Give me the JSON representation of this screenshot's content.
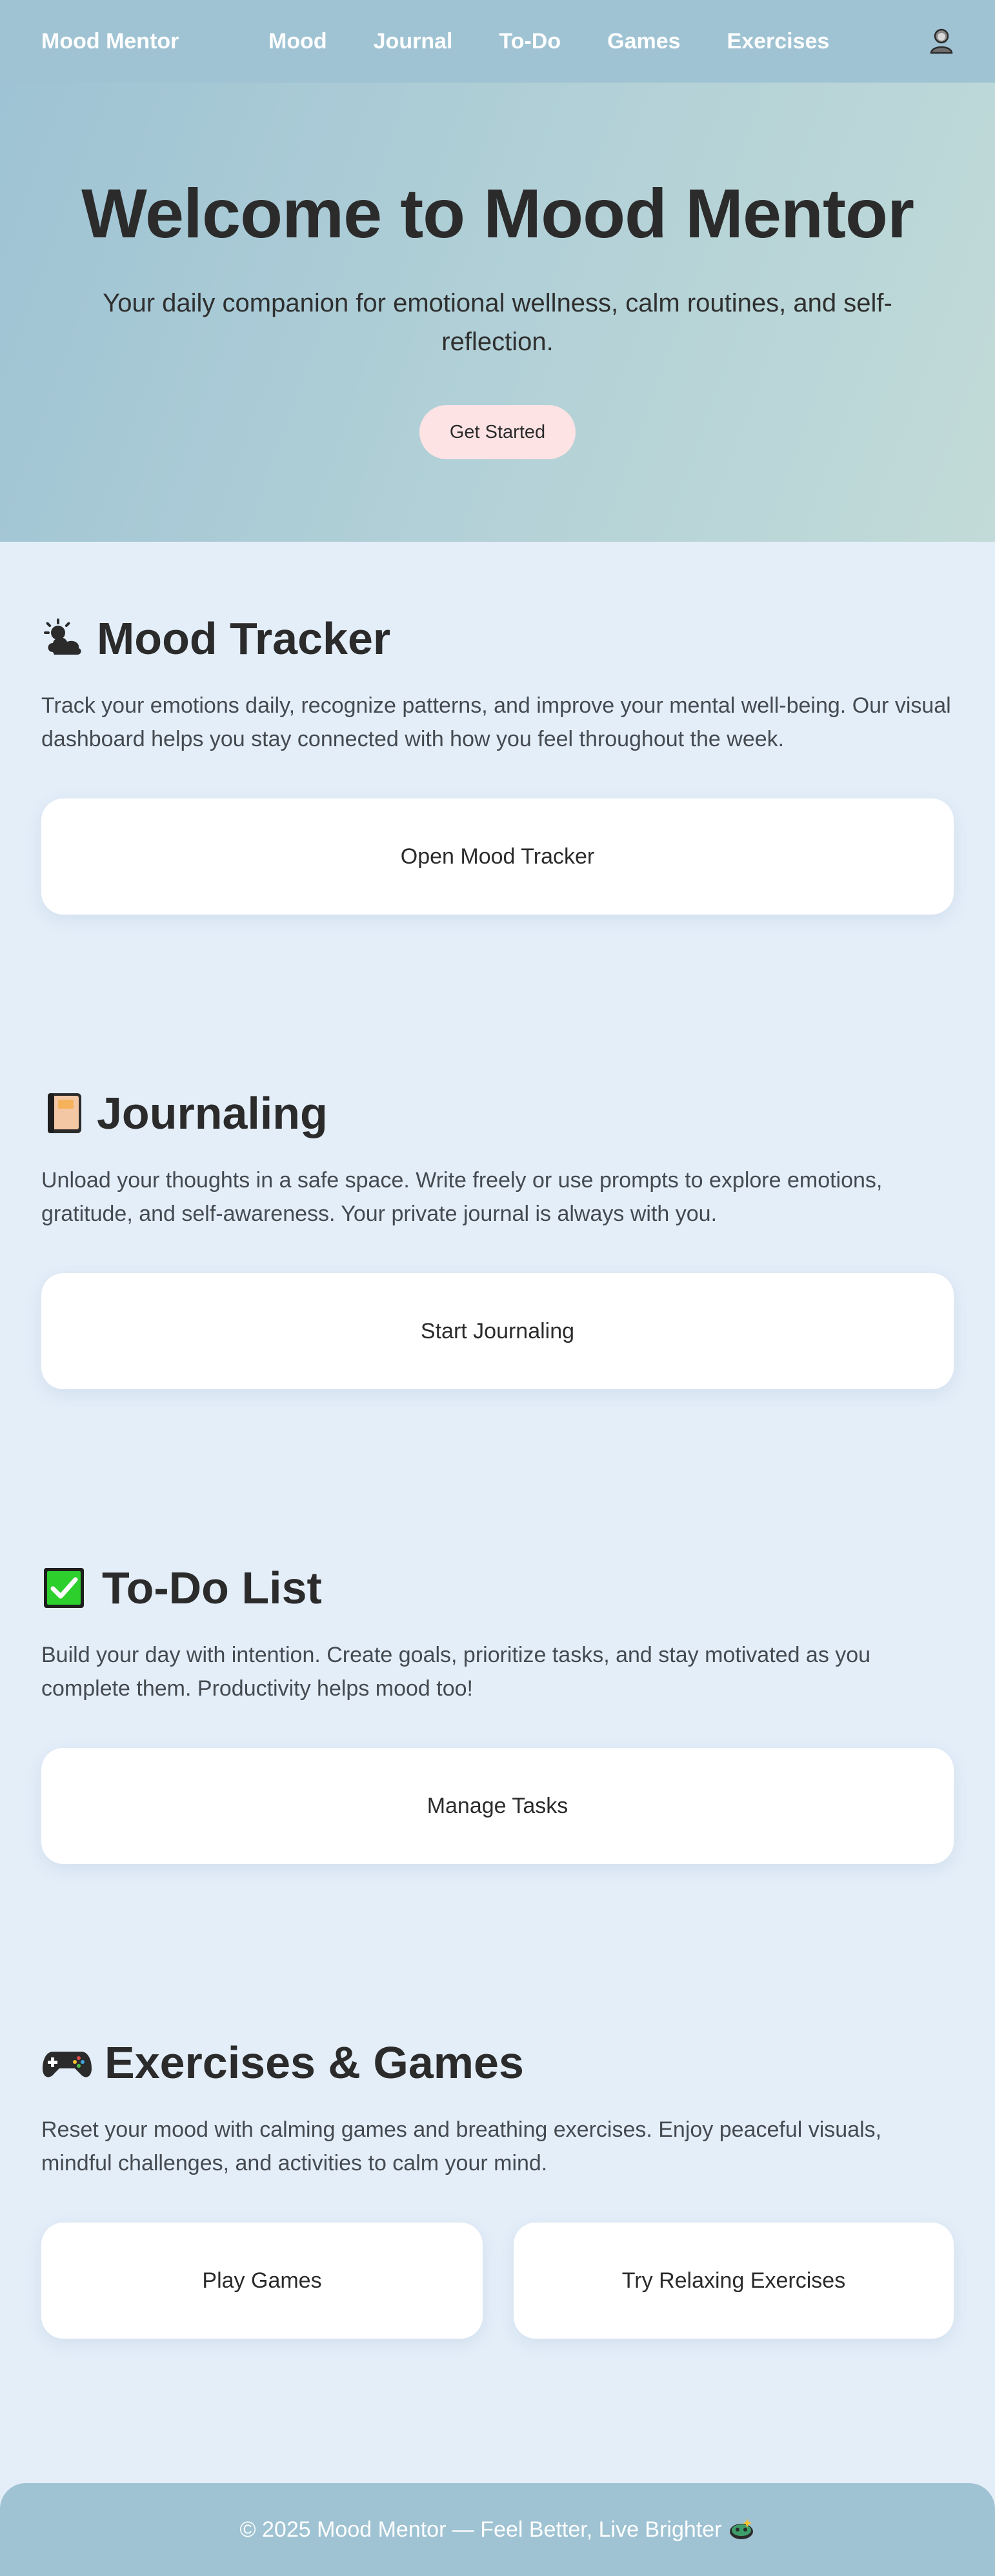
{
  "nav": {
    "brand": "Mood Mentor",
    "links": [
      "Mood",
      "Journal",
      "To-Do",
      "Games",
      "Exercises"
    ],
    "profile_icon": "profile-icon"
  },
  "hero": {
    "title": "Welcome to Mood Mentor",
    "subtitle": "Your daily companion for emotional wellness, calm routines, and self-reflection.",
    "cta": "Get Started"
  },
  "sections": {
    "mood": {
      "icon": "sun-behind-cloud-icon",
      "title": "Mood Tracker",
      "description": "Track your emotions daily, recognize patterns, and improve your mental well-being. Our visual dashboard helps you stay connected with how you feel throughout the week.",
      "button": "Open Mood Tracker"
    },
    "journal": {
      "icon": "notebook-icon",
      "title": "Journaling",
      "description": "Unload your thoughts in a safe space. Write freely or use prompts to explore emotions, gratitude, and self-awareness. Your private journal is always with you.",
      "button": "Start Journaling"
    },
    "todo": {
      "icon": "check-mark-icon",
      "title": "To-Do List",
      "description": "Build your day with intention. Create goals, prioritize tasks, and stay motivated as you complete them. Productivity helps mood too!",
      "button": "Manage Tasks"
    },
    "games": {
      "icon": "game-controller-icon",
      "title": "Exercises & Games",
      "description": "Reset your mood with calming games and breathing exercises. Enjoy peaceful visuals, mindful challenges, and activities to calm your mind.",
      "button_games": "Play Games",
      "button_exercises": "Try Relaxing Exercises"
    }
  },
  "footer": {
    "text": "© 2025 Mood Mentor — Feel Better, Live Brighter",
    "icon": "sparkle-face-icon"
  },
  "colors": {
    "nav_bg": "#9fc3d3",
    "page_bg": "#e4eef9",
    "cta_bg": "#fde3e4",
    "card_bg": "#ffffff",
    "text": "#2b2b2b"
  }
}
